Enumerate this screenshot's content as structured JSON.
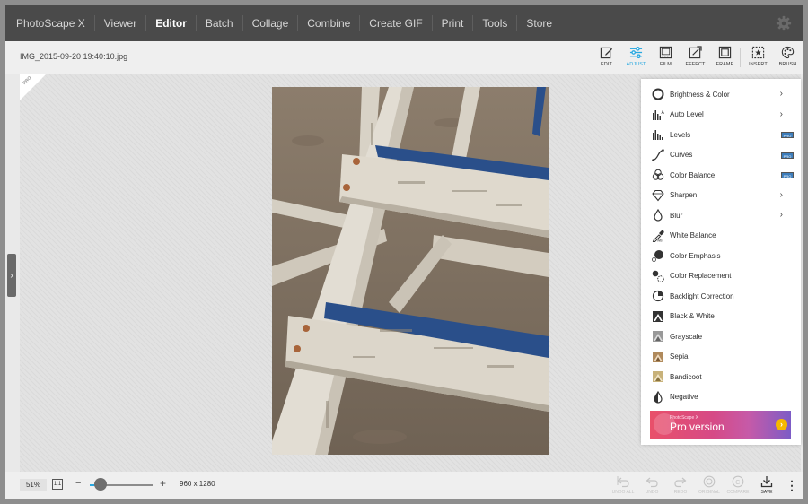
{
  "nav": {
    "items": [
      "PhotoScape X",
      "Viewer",
      "Editor",
      "Batch",
      "Collage",
      "Combine",
      "Create GIF",
      "Print",
      "Tools",
      "Store"
    ],
    "active": "Editor",
    "settings_icon": "gear-icon"
  },
  "toolbar": {
    "filename": "IMG_2015-09-20 19:40:10.jpg",
    "tools": [
      {
        "label": "EDIT",
        "icon": "edit-icon",
        "active": false
      },
      {
        "label": "ADJUST",
        "icon": "sliders-icon",
        "active": true
      },
      {
        "label": "FILM",
        "icon": "film-icon",
        "active": false
      },
      {
        "label": "EFFECT",
        "icon": "effect-icon",
        "active": false
      },
      {
        "label": "FRAME",
        "icon": "frame-icon",
        "active": false
      },
      {
        "label": "INSERT",
        "icon": "insert-icon",
        "active": false
      },
      {
        "label": "BRUSH",
        "icon": "palette-icon",
        "active": false
      }
    ],
    "accent": "#28a8e0"
  },
  "canvas": {
    "pro_corner": "PRO"
  },
  "adjust_menu": {
    "items": [
      {
        "label": "Brightness & Color",
        "icon": "circle-icon",
        "submenu": true,
        "pro": false
      },
      {
        "label": "Auto Level",
        "icon": "histogram-auto-icon",
        "submenu": true,
        "pro": false
      },
      {
        "label": "Levels",
        "icon": "histogram-icon",
        "submenu": false,
        "pro": true
      },
      {
        "label": "Curves",
        "icon": "curve-icon",
        "submenu": false,
        "pro": true
      },
      {
        "label": "Color Balance",
        "icon": "color-balance-icon",
        "submenu": false,
        "pro": true
      },
      {
        "label": "Sharpen",
        "icon": "diamond-icon",
        "submenu": true,
        "pro": false
      },
      {
        "label": "Blur",
        "icon": "drop-icon",
        "submenu": true,
        "pro": false
      },
      {
        "label": "White Balance",
        "icon": "eyedropper-icon",
        "submenu": false,
        "pro": false
      },
      {
        "label": "Color Emphasis",
        "icon": "color-emphasis-icon",
        "submenu": false,
        "pro": false
      },
      {
        "label": "Color Replacement",
        "icon": "color-replace-icon",
        "submenu": false,
        "pro": false
      },
      {
        "label": "Backlight Correction",
        "icon": "backlight-icon",
        "submenu": false,
        "pro": false
      },
      {
        "label": "Black & White",
        "icon": "bw-icon",
        "submenu": false,
        "pro": false
      },
      {
        "label": "Grayscale",
        "icon": "grayscale-icon",
        "submenu": false,
        "pro": false
      },
      {
        "label": "Sepia",
        "icon": "sepia-icon",
        "submenu": false,
        "pro": false
      },
      {
        "label": "Bandicoot",
        "icon": "bandicoot-icon",
        "submenu": false,
        "pro": false
      },
      {
        "label": "Negative",
        "icon": "negative-drop-icon",
        "submenu": false,
        "pro": false
      }
    ],
    "pro_badge": "PRO",
    "promo": {
      "small": "PhotoScape X",
      "big": "Pro version"
    }
  },
  "bottombar": {
    "zoom": "51%",
    "one_to_one": "1:1",
    "minus": "−",
    "plus": "+",
    "zoom_fraction": 0.17,
    "image_size": "960 x 1280",
    "actions": [
      {
        "label": "UNDO ALL",
        "icon": "undo-all-icon",
        "enabled": false
      },
      {
        "label": "UNDO",
        "icon": "undo-icon",
        "enabled": false
      },
      {
        "label": "REDO",
        "icon": "redo-icon",
        "enabled": false
      },
      {
        "label": "ORIGINAL",
        "icon": "original-icon",
        "enabled": false
      },
      {
        "label": "COMPARE",
        "icon": "compare-icon",
        "enabled": false
      },
      {
        "label": "SAVE",
        "icon": "save-icon",
        "enabled": true
      }
    ],
    "more": "⋮"
  }
}
